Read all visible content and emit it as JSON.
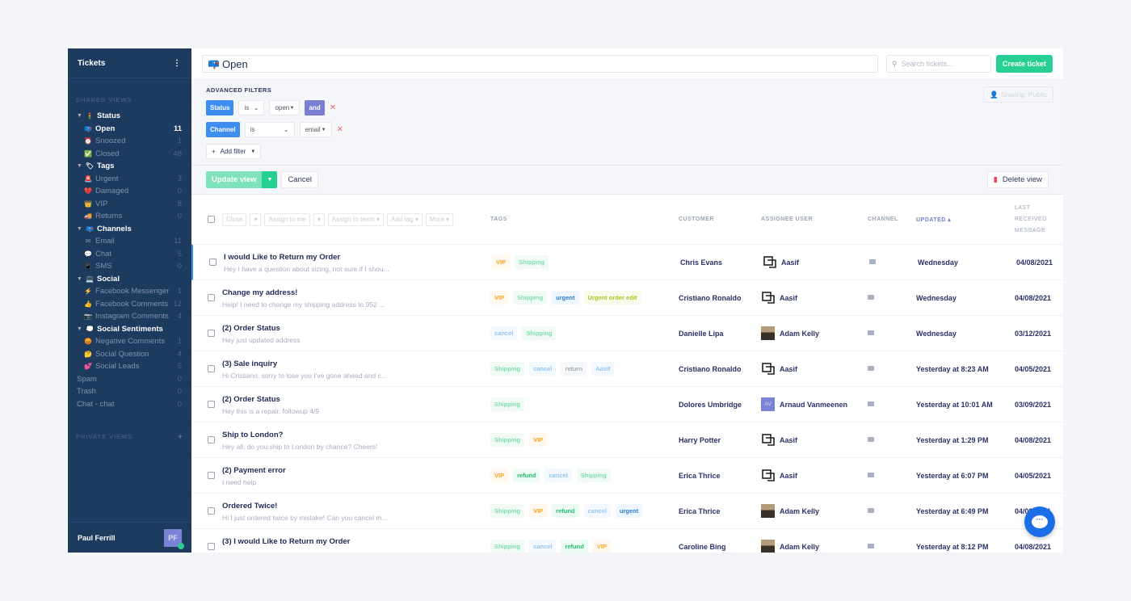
{
  "sidebar": {
    "title": "Tickets",
    "menu_icon": "kebab-icon",
    "shared_views_label": "SHARED VIEWS",
    "private_views_label": "PRIVATE VIEWS",
    "items": [
      {
        "type": "group",
        "label": "Status",
        "icon": "🚦"
      },
      {
        "type": "item",
        "label": "Open",
        "count": "11",
        "icon": "📪",
        "active": true
      },
      {
        "type": "item",
        "label": "Snoozed",
        "count": "1",
        "icon": "⏰"
      },
      {
        "type": "item",
        "label": "Closed",
        "count": "48",
        "icon": "✅"
      },
      {
        "type": "group",
        "label": "Tags",
        "icon": "🏷"
      },
      {
        "type": "item",
        "label": "Urgent",
        "count": "3",
        "icon": "🚨"
      },
      {
        "type": "item",
        "label": "Damaged",
        "count": "0",
        "icon": "💔"
      },
      {
        "type": "item",
        "label": "VIP",
        "count": "8",
        "icon": "👑"
      },
      {
        "type": "item",
        "label": "Returns",
        "count": "0",
        "icon": "🚚"
      },
      {
        "type": "group",
        "label": "Channels",
        "icon": "📪"
      },
      {
        "type": "item",
        "label": "Email",
        "count": "11",
        "icon": "✉"
      },
      {
        "type": "item",
        "label": "Chat",
        "count": "5",
        "icon": "💬"
      },
      {
        "type": "item",
        "label": "SMS",
        "count": "0",
        "icon": "📱"
      },
      {
        "type": "group",
        "label": "Social",
        "icon": "💻"
      },
      {
        "type": "item",
        "label": "Facebook Messenger",
        "count": "1",
        "icon": "⚡"
      },
      {
        "type": "item",
        "label": "Facebook Comments",
        "count": "12",
        "icon": "👍"
      },
      {
        "type": "item",
        "label": "Instagram Comments",
        "count": "4",
        "icon": "📷"
      },
      {
        "type": "group",
        "label": "Social Sentiments",
        "icon": "💭"
      },
      {
        "type": "item",
        "label": "Negative Comments",
        "count": "1",
        "icon": "😡"
      },
      {
        "type": "item",
        "label": "Social Question",
        "count": "4",
        "icon": "🤔"
      },
      {
        "type": "item",
        "label": "Social Leads",
        "count": "5",
        "icon": "💕"
      },
      {
        "type": "top",
        "label": "Spam",
        "count": "0"
      },
      {
        "type": "top",
        "label": "Trash",
        "count": "0"
      },
      {
        "type": "top",
        "label": "Chat - chat",
        "count": "0"
      }
    ],
    "user": {
      "name": "Paul Ferrill",
      "initials": "PF",
      "status": "online"
    }
  },
  "header": {
    "view_icon": "📪",
    "view_title": "Open",
    "search_placeholder": "Search tickets...",
    "create_label": "Create ticket"
  },
  "filters": {
    "heading": "ADVANCED FILTERS",
    "sharing_label": "Sharing: Public",
    "rows": [
      {
        "field": "Status",
        "op": "is",
        "value": "open",
        "conj": "and"
      },
      {
        "field": "Channel",
        "op": "is",
        "value": "email"
      }
    ],
    "add_filter": "Add filter"
  },
  "actions": {
    "update_label": "Update view",
    "cancel_label": "Cancel",
    "delete_label": "Delete view"
  },
  "table": {
    "bulk": [
      "Close",
      "Assign to me",
      "Assign to team",
      "Add tag",
      "More"
    ],
    "columns": {
      "tags": "TAGS",
      "customer": "CUSTOMER",
      "assignee": "ASSIGNEE USER",
      "channel": "CHANNEL",
      "updated": "UPDATED ▴",
      "last": "LAST RECEIVED MESSAGE"
    },
    "rows": [
      {
        "subject": "I would Like to Return my Order",
        "preview": "Hey I have a question about sizing, not sure if I shou...",
        "tags": [
          "VIP",
          "Shipping"
        ],
        "customer": "Chris Evans",
        "assignee": "Aasif",
        "avatar": "logo",
        "updated": "Wednesday",
        "last": "04/08/2021",
        "selected": true
      },
      {
        "subject": "Change my address!",
        "preview": "Help! I need to change my shipping address to 952 ...",
        "tags": [
          "VIP",
          "Shipping",
          "urgent",
          "Urgent order edit"
        ],
        "customer": "Cristiano Ronaldo",
        "assignee": "Aasif",
        "avatar": "logo",
        "updated": "Wednesday",
        "last": "04/08/2021"
      },
      {
        "subject": "(2) Order Status",
        "preview": "Hey just updated address",
        "tags": [
          "cancel",
          "Shipping"
        ],
        "customer": "Danielle Lipa",
        "assignee": "Adam Kelly",
        "avatar": "photo",
        "updated": "Wednesday",
        "last": "03/12/2021"
      },
      {
        "subject": "(3) Sale inquiry",
        "preview": "Hi Cristiano, sorry to lose you I've gone ahead and c...",
        "tags": [
          "Shipping",
          "cancel",
          "return",
          "Aasif"
        ],
        "customer": "Cristiano Ronaldo",
        "assignee": "Aasif",
        "avatar": "logo",
        "updated": "Yesterday at 8:23 AM",
        "last": "04/05/2021"
      },
      {
        "subject": "(2) Order Status",
        "preview": "Hey this is a repair, followup 4/9",
        "tags": [
          "Shipping"
        ],
        "customer": "Dolores Umbridge",
        "assignee": "Arnaud Vanmeenen",
        "avatar": "AV",
        "updated": "Yesterday at 10:01 AM",
        "last": "03/09/2021"
      },
      {
        "subject": "Ship to London?",
        "preview": "Hey all, do you ship to London by chance? Cheers!",
        "tags": [
          "Shipping",
          "VIP"
        ],
        "customer": "Harry Potter",
        "assignee": "Aasif",
        "avatar": "logo",
        "updated": "Yesterday at 1:29 PM",
        "last": "04/08/2021"
      },
      {
        "subject": "(2) Payment error",
        "preview": "I need help",
        "tags": [
          "VIP",
          "refund",
          "cancel",
          "Shipping"
        ],
        "customer": "Erica Thrice",
        "assignee": "Aasif",
        "avatar": "logo",
        "updated": "Yesterday at 6:07 PM",
        "last": "04/05/2021"
      },
      {
        "subject": "Ordered Twice!",
        "preview": "Hi I just ordered twice by mistake! Can you cancel m...",
        "tags": [
          "Shipping",
          "VIP",
          "refund",
          "cancel",
          "urgent"
        ],
        "customer": "Erica Thrice",
        "assignee": "Adam Kelly",
        "avatar": "photo",
        "updated": "Yesterday at 6:49 PM",
        "last": "04/08/2021"
      },
      {
        "subject": "(3) I would Like to Return my Order",
        "preview": "",
        "tags": [
          "Shipping",
          "cancel",
          "refund",
          "VIP"
        ],
        "customer": "Caroline Bing",
        "assignee": "Adam Kelly",
        "avatar": "photo",
        "updated": "Yesterday at 8:12 PM",
        "last": "04/08/2021"
      }
    ]
  },
  "tag_colors": {
    "VIP": [
      "#fff8ec",
      "#f5a623"
    ],
    "Shipping": [
      "#f1fbf6",
      "#7fdcab"
    ],
    "urgent": [
      "#eef6ff",
      "#2f7bd9"
    ],
    "Urgent order edit": [
      "#f8fbea",
      "#a6c62e"
    ],
    "cancel": [
      "#f3f9ff",
      "#93c5f2"
    ],
    "return": [
      "#f6f7f9",
      "#a5aab6"
    ],
    "Aasif": [
      "#f3f9ff",
      "#93c5f2"
    ],
    "refund": [
      "#ecfbf3",
      "#1fbf72"
    ]
  },
  "colors": {
    "sidebar": "#1d3a5f",
    "accent_green": "#27d092",
    "accent_blue": "#3d8ef0"
  }
}
